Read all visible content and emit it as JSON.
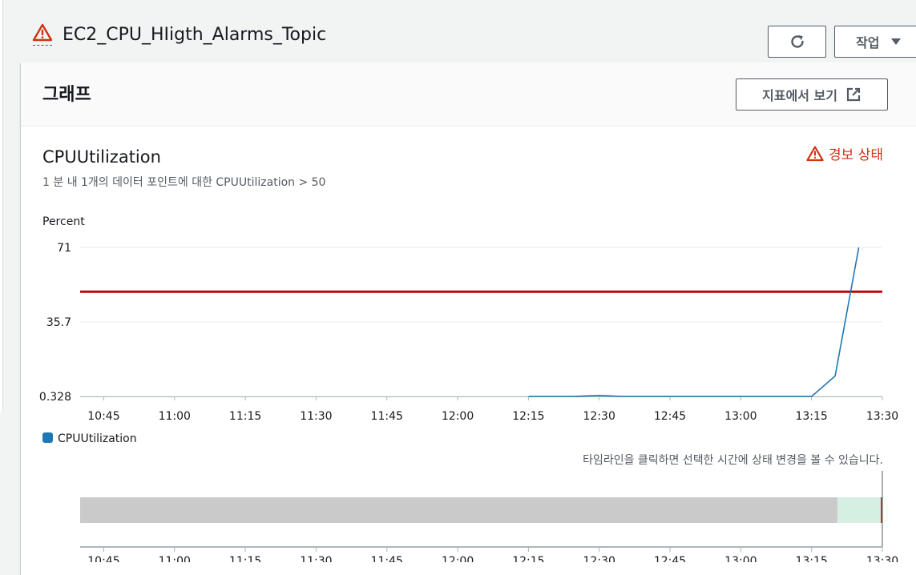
{
  "header": {
    "title": "EC2_CPU_HIigth_Alarms_Topic",
    "alarm_icon": "warning-triangle-icon",
    "refresh_icon": "refresh-icon",
    "actions_label": "작업",
    "actions_icon": "caret-down-icon"
  },
  "panel": {
    "title": "그래프",
    "view_in_metrics_label": "지표에서 보기",
    "external_link_icon": "external-link-icon"
  },
  "chart_header": {
    "title": "CPUUtilization",
    "subtitle": "1 분 내 1개의 데이터 포인트에 대한 CPUUtilization > 50",
    "status_label": "경보 상태",
    "status_color": "#d13212"
  },
  "timeline": {
    "hint": "타임라인을 클릭하면 선택한 시간에 상태 변경을 볼 수 있습니다.",
    "segments": [
      {
        "state": "insufficient-data",
        "color": "#cacaca",
        "from": 0.0,
        "to": 0.944
      },
      {
        "state": "ok",
        "color": "#d5efe2",
        "from": 0.944,
        "to": 0.998
      },
      {
        "state": "alarm",
        "color": "#d13212",
        "from": 0.998,
        "to": 1.0
      }
    ],
    "ticks": [
      "10:45",
      "11:00",
      "11:15",
      "11:30",
      "11:45",
      "12:00",
      "12:15",
      "12:30",
      "12:45",
      "13:00",
      "13:15",
      "13:30"
    ]
  },
  "chart_data": {
    "type": "line",
    "ylabel": "Percent",
    "yticks": [
      "71",
      "35.7",
      "0.328"
    ],
    "ylim": [
      0.328,
      71
    ],
    "xlim": [
      "10:40",
      "13:30"
    ],
    "xticks": [
      "10:45",
      "11:00",
      "11:15",
      "11:30",
      "11:45",
      "12:00",
      "12:15",
      "12:30",
      "12:45",
      "13:00",
      "13:15",
      "13:30"
    ],
    "threshold": 50,
    "threshold_color": "#c00000",
    "series": [
      {
        "name": "CPUUtilization",
        "color": "#1f77b4",
        "points": [
          [
            "12:15",
            0.33
          ],
          [
            "12:20",
            0.33
          ],
          [
            "12:25",
            0.35
          ],
          [
            "12:30",
            0.8
          ],
          [
            "12:35",
            0.33
          ],
          [
            "12:45",
            0.33
          ],
          [
            "13:00",
            0.33
          ],
          [
            "13:15",
            0.33
          ],
          [
            "13:20",
            10.0
          ],
          [
            "13:25",
            71.0
          ]
        ]
      }
    ],
    "legend": "bottom-left",
    "grid": true
  }
}
